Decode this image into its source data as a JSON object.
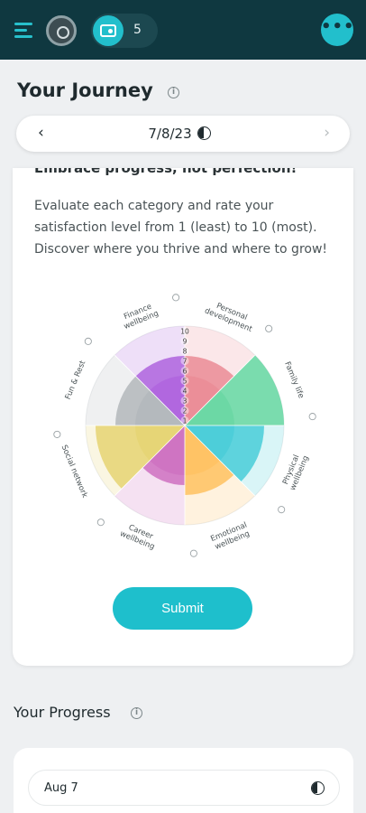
{
  "header": {
    "badge_count": "5",
    "more_label": "•••"
  },
  "journey": {
    "title": "Your Journey",
    "info_glyph": "i",
    "date": "7/8/23",
    "prev_glyph": "‹",
    "next_glyph": "›"
  },
  "card": {
    "heading": "Embrace progress, not perfection!",
    "description": "Evaluate each category and rate your satisfaction level from 1 (least) to 10 (most). Discover where you thrive and where to grow!",
    "submit_label": "Submit"
  },
  "wheel": {
    "scale_labels": [
      "1",
      "2",
      "3",
      "4",
      "5",
      "6",
      "7",
      "8",
      "9",
      "10"
    ],
    "categories": [
      {
        "name": "Personal development",
        "line1": "Personal",
        "line2": "development",
        "color": "#e77b86",
        "rating": 7
      },
      {
        "name": "Family life",
        "line1": "Family life",
        "line2": "",
        "color": "#52d195",
        "rating": 10
      },
      {
        "name": "Physical wellbeing",
        "line1": "Physical",
        "line2": "wellbeing",
        "color": "#2ec6d2",
        "rating": 8
      },
      {
        "name": "Emotional wellbeing",
        "line1": "Emotional",
        "line2": "wellbeing",
        "color": "#ffb84a",
        "rating": 7
      },
      {
        "name": "Career wellbeing",
        "line1": "Career",
        "line2": "wellbeing",
        "color": "#c75bb7",
        "rating": 6
      },
      {
        "name": "Social network",
        "line1": "Social network",
        "line2": "",
        "color": "#e2cd5e",
        "rating": 9
      },
      {
        "name": "Fun & Rest",
        "line1": "Fun & Rest",
        "line2": "",
        "color": "#a7adb1",
        "rating": 7
      },
      {
        "name": "Finance wellbeing",
        "line1": "Finance",
        "line2": "wellbeing",
        "color": "#a34ed9",
        "rating": 7
      }
    ]
  },
  "progress": {
    "title": "Your Progress",
    "info_glyph": "i",
    "entries": [
      {
        "date": "Aug 7"
      }
    ]
  }
}
